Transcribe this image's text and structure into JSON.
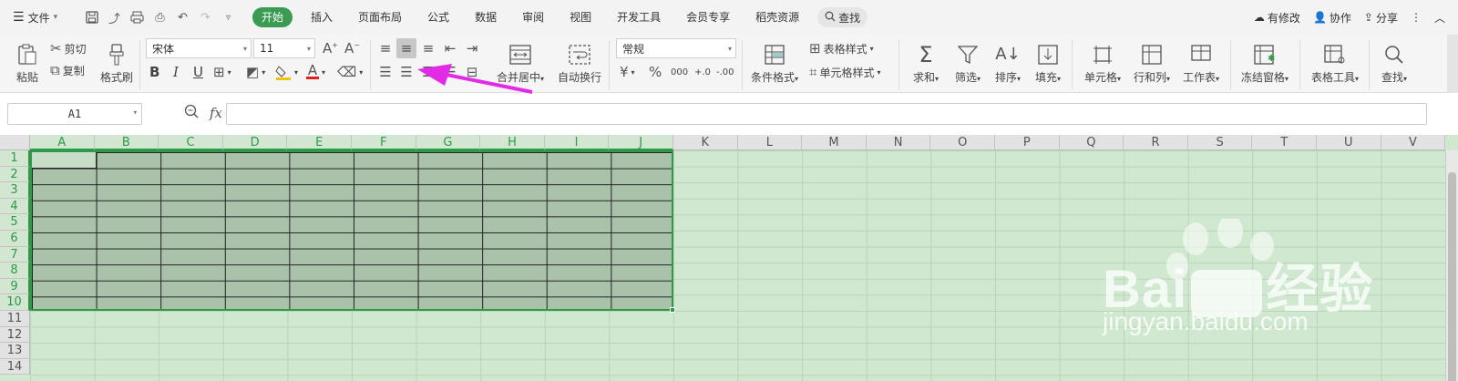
{
  "menubar": {
    "file_label": "文件",
    "tabs": [
      {
        "label": "开始",
        "active": true
      },
      {
        "label": "插入"
      },
      {
        "label": "页面布局"
      },
      {
        "label": "公式"
      },
      {
        "label": "数据"
      },
      {
        "label": "审阅"
      },
      {
        "label": "视图"
      },
      {
        "label": "开发工具"
      },
      {
        "label": "会员专享"
      },
      {
        "label": "稻壳资源"
      }
    ],
    "search_label": "查找",
    "right": {
      "modified": "有修改",
      "collab": "协作",
      "share": "分享"
    },
    "accent_color": "#3b9b52"
  },
  "ribbon": {
    "paste": "粘贴",
    "cut": "剪切",
    "copy": "复制",
    "format_painter": "格式刷",
    "font_name": "宋体",
    "font_size": "11",
    "number_format": "常规",
    "merge_center": "合并居中",
    "wrap_text": "自动换行",
    "cond_format": "条件格式",
    "table_style": "表格样式",
    "cell_style": "单元格样式",
    "sum": "求和",
    "filter": "筛选",
    "sort": "排序",
    "fill": "填充",
    "cells": "单元格",
    "rows_cols": "行和列",
    "worksheet": "工作表",
    "freeze": "冻结窗格",
    "table_tools": "表格工具",
    "find": "查找",
    "bold": "B",
    "italic": "I",
    "underline": "U",
    "font_color_glyph": "A",
    "percent": "%",
    "thousands": "000",
    "inc_dec": "+.0",
    "dec_dec": "-.00",
    "currency": "¥"
  },
  "formula_bar": {
    "name_box": "A1",
    "fx": "fx",
    "value": ""
  },
  "grid": {
    "columns": [
      "A",
      "B",
      "C",
      "D",
      "E",
      "F",
      "G",
      "H",
      "I",
      "J",
      "K",
      "L",
      "M",
      "N",
      "O",
      "P",
      "Q",
      "R",
      "S",
      "T",
      "U",
      "V"
    ],
    "rows": [
      "1",
      "2",
      "3",
      "4",
      "5",
      "6",
      "7",
      "8",
      "9",
      "10",
      "11",
      "12",
      "13",
      "14"
    ],
    "selected_range": "A1:J10",
    "selection_color": "#2e9a47"
  },
  "watermark": {
    "brand": "Bai",
    "brand_suffix": "经验",
    "url": "jingyan.baidu.com"
  }
}
